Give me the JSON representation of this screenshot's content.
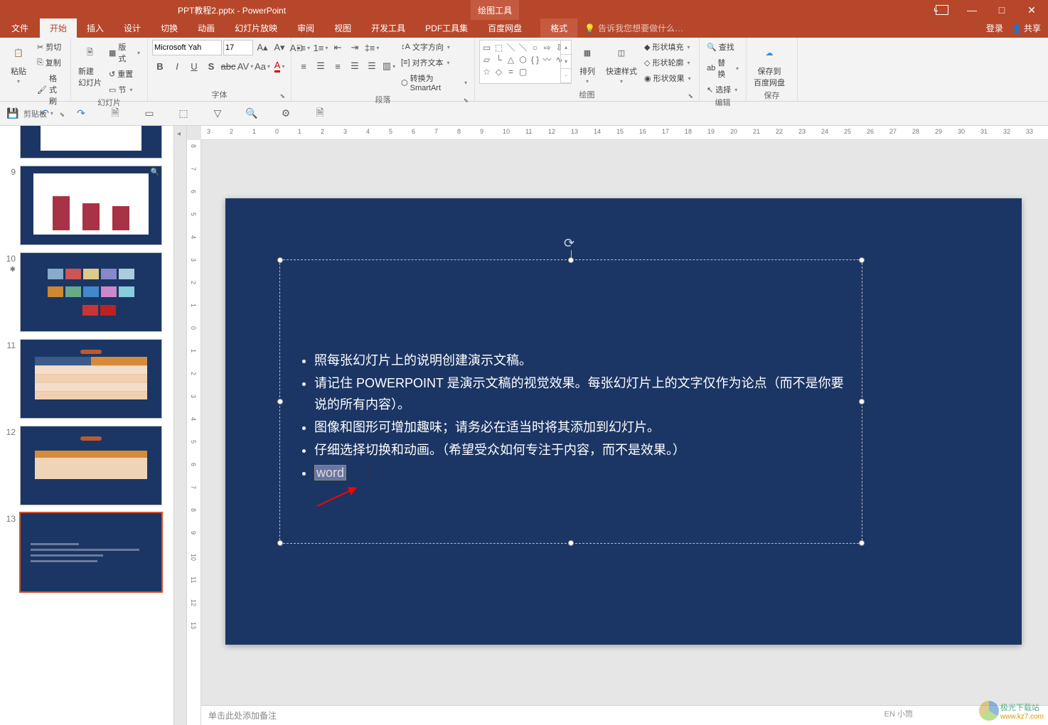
{
  "titlebar": {
    "filename": "PPT教程2.pptx - PowerPoint",
    "context_group": "绘图工具"
  },
  "tabs": {
    "file": "文件",
    "home": "开始",
    "insert": "插入",
    "design": "设计",
    "transition": "切换",
    "animation": "动画",
    "slideshow": "幻灯片放映",
    "review": "审阅",
    "view": "视图",
    "developer": "开发工具",
    "pdf": "PDF工具集",
    "baidu": "百度网盘",
    "format": "格式",
    "tell_me": "告诉我您想要做什么…",
    "login": "登录",
    "share": "共享"
  },
  "ribbon": {
    "clipboard": {
      "label": "剪贴板",
      "paste": "粘贴",
      "cut": "剪切",
      "copy": "复制",
      "format_painter": "格式刷"
    },
    "slides": {
      "label": "幻灯片",
      "new_slide": "新建\n幻灯片",
      "layout": "版式",
      "reset": "重置",
      "section": "节"
    },
    "font": {
      "label": "字体",
      "font_name": "Microsoft Yah",
      "font_size": "17"
    },
    "paragraph": {
      "label": "段落",
      "text_dir": "文字方向",
      "align_text": "对齐文本",
      "to_smartart": "转换为 SmartArt"
    },
    "drawing": {
      "label": "绘图",
      "arrange": "排列",
      "quick_style": "快速样式",
      "shape_fill": "形状填充",
      "shape_outline": "形状轮廓",
      "shape_effects": "形状效果"
    },
    "editing": {
      "label": "编辑",
      "find": "查找",
      "replace": "替换",
      "select": "选择"
    },
    "save": {
      "label": "保存",
      "save_to": "保存到\n百度网盘"
    }
  },
  "slides_panel": [
    {
      "num": ""
    },
    {
      "num": "9"
    },
    {
      "num": "10"
    },
    {
      "num": "11"
    },
    {
      "num": "12"
    },
    {
      "num": "13"
    }
  ],
  "ruler_h": [
    "3",
    "2",
    "1",
    "0",
    "1",
    "2",
    "3",
    "4",
    "5",
    "6",
    "7",
    "8",
    "9",
    "10",
    "11",
    "12",
    "13",
    "14",
    "15",
    "16",
    "17",
    "18",
    "19",
    "20",
    "21",
    "22",
    "23",
    "24",
    "25",
    "26",
    "27",
    "28",
    "29",
    "30",
    "31",
    "32",
    "33"
  ],
  "ruler_v": [
    "8",
    "7",
    "6",
    "5",
    "4",
    "3",
    "2",
    "1",
    "0",
    "1",
    "2",
    "3",
    "4",
    "5",
    "6",
    "7",
    "8",
    "9",
    "10",
    "11",
    "12",
    "13"
  ],
  "slide_content": {
    "bullets": [
      "照每张幻灯片上的说明创建演示文稿。",
      "请记住 POWERPOINT 是演示文稿的视觉效果。每张幻灯片上的文字仅作为论点（而不是你要说的所有内容）。",
      "图像和图形可增加趣味；请务必在适当时将其添加到幻灯片。",
      "仔细选择切换和动画。（希望受众如何专注于内容，而不是效果。）"
    ],
    "typed": "word"
  },
  "notes": {
    "placeholder": "单击此处添加备注"
  },
  "ime": "EN 小筒",
  "watermark": {
    "line1": "极光下载站",
    "line2": "www.kz7.com"
  }
}
